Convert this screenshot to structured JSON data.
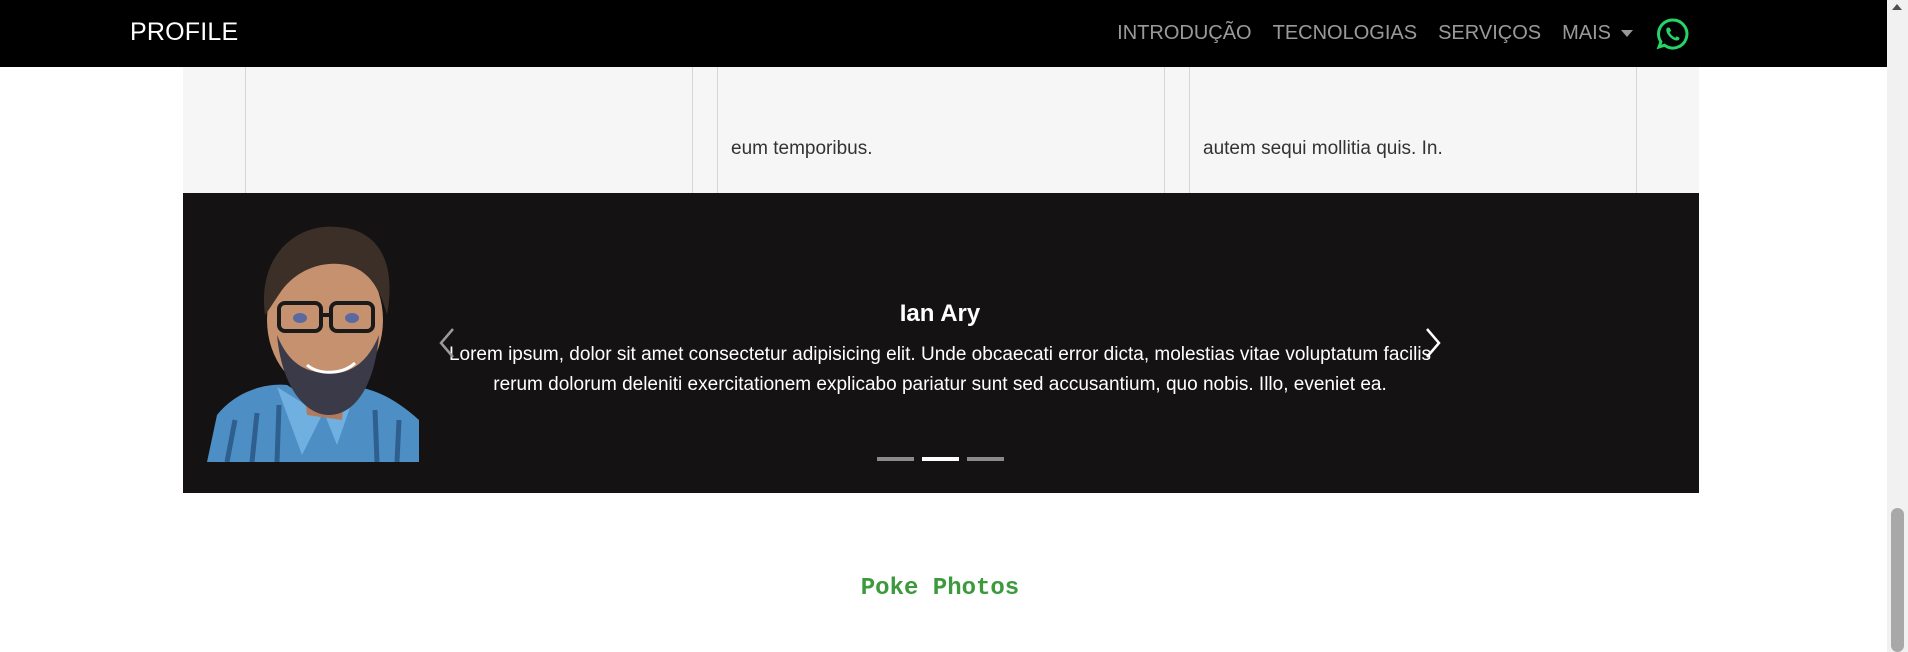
{
  "navbar": {
    "brand": "PROFILE",
    "links": [
      "INTRODUÇÃO",
      "TECNOLOGIAS",
      "SERVIÇOS",
      "MAIS"
    ],
    "whatsapp_icon": "whatsapp-icon",
    "whatsapp_color": "#25d366"
  },
  "cards": [
    {
      "text": ""
    },
    {
      "text": "eum temporibus."
    },
    {
      "text": "autem sequi mollitia quis. In."
    }
  ],
  "testimonial": {
    "name": "Ian Ary",
    "quote": "Lorem ipsum, dolor sit amet consectetur adipisicing elit. Unde obcaecati error dicta, molestias vitae voluptatum facilis rerum dolorum deleniti exercitationem explicabo pariatur sunt sed accusantium, quo nobis. Illo, eveniet ea.",
    "active_slide": 2,
    "slide_count": 3
  },
  "section": {
    "title": "Poke Photos"
  },
  "colors": {
    "navbar_bg": "#000000",
    "testimonial_bg": "#141213",
    "section_bg": "#f6f6f6",
    "accent_green": "#3c9a3c"
  }
}
